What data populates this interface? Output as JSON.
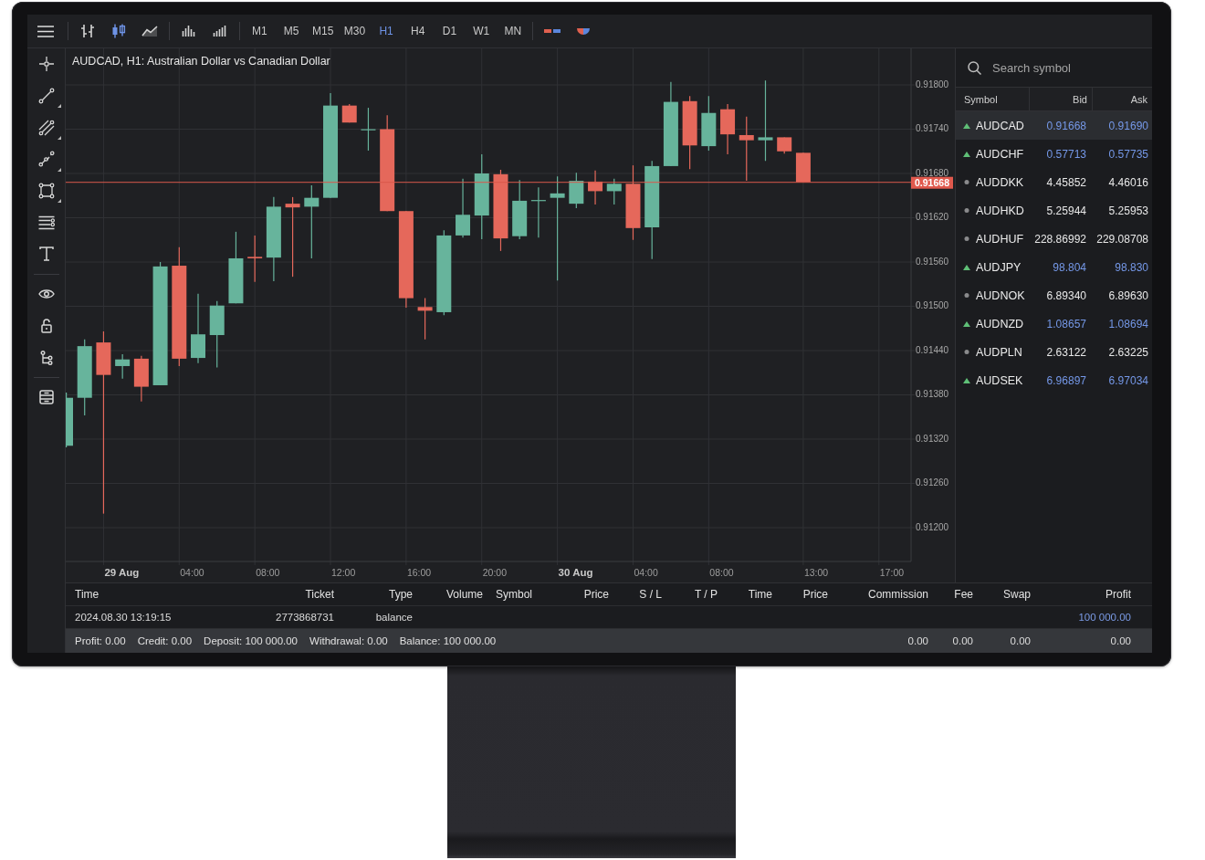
{
  "toolbar": {
    "chart_types": [
      {
        "kind": "bars",
        "selected": false
      },
      {
        "kind": "candles",
        "selected": true
      },
      {
        "kind": "line",
        "selected": false
      }
    ],
    "volume_tools": [
      {
        "kind": "histogram"
      },
      {
        "kind": "rising_bars"
      }
    ],
    "timeframes": [
      {
        "label": "M1",
        "selected": false
      },
      {
        "label": "M5",
        "selected": false
      },
      {
        "label": "M15",
        "selected": false
      },
      {
        "label": "M30",
        "selected": false
      },
      {
        "label": "H1",
        "selected": true
      },
      {
        "label": "H4",
        "selected": false
      },
      {
        "label": "D1",
        "selected": false
      },
      {
        "label": "W1",
        "selected": false
      },
      {
        "label": "MN",
        "selected": false
      }
    ],
    "extras": [
      {
        "kind": "dashes"
      },
      {
        "kind": "half_disc"
      }
    ]
  },
  "drawing_tools": {
    "groups": [
      {
        "items": [
          {
            "kind": "crosshair",
            "submenu": false
          },
          {
            "kind": "line",
            "submenu": true
          },
          {
            "kind": "channel",
            "submenu": true
          },
          {
            "kind": "polyline",
            "submenu": true
          },
          {
            "kind": "rectangle",
            "submenu": true
          },
          {
            "kind": "levels",
            "submenu": false
          },
          {
            "kind": "text",
            "submenu": false
          }
        ]
      },
      {
        "items": [
          {
            "kind": "eye",
            "submenu": false
          },
          {
            "kind": "lock",
            "submenu": false
          },
          {
            "kind": "tree",
            "submenu": false
          }
        ]
      },
      {
        "items": [
          {
            "kind": "layers",
            "submenu": false
          }
        ]
      }
    ]
  },
  "chart": {
    "title": "AUDCAD, H1: Australian Dollar vs Canadian Dollar",
    "price_axis": [
      "0.91800",
      "0.91740",
      "0.91680",
      "0.91620",
      "0.91560",
      "0.91500",
      "0.91440",
      "0.91380",
      "0.91320",
      "0.91260",
      "0.91200"
    ],
    "time_axis": [
      {
        "label": "29 Aug",
        "kind": "date"
      },
      {
        "label": "04:00",
        "kind": "time"
      },
      {
        "label": "08:00",
        "kind": "time"
      },
      {
        "label": "12:00",
        "kind": "time"
      },
      {
        "label": "16:00",
        "kind": "time"
      },
      {
        "label": "20:00",
        "kind": "time"
      },
      {
        "label": "30 Aug",
        "kind": "date"
      },
      {
        "label": "04:00",
        "kind": "time"
      },
      {
        "label": "08:00",
        "kind": "time"
      },
      {
        "label": "13:00",
        "kind": "time"
      },
      {
        "label": "17:00",
        "kind": "time"
      }
    ],
    "current_price": "0.91668"
  },
  "watchlist": {
    "search": {
      "placeholder": "Search symbol"
    },
    "columns": [
      "Symbol",
      "Bid",
      "Ask"
    ],
    "rows": [
      {
        "symbol": "AUDCAD",
        "bid": "0.91668",
        "ask": "0.91690",
        "rising": true,
        "selected": true
      },
      {
        "symbol": "AUDCHF",
        "bid": "0.57713",
        "ask": "0.57735",
        "rising": true,
        "selected": false
      },
      {
        "symbol": "AUDDKK",
        "bid": "4.45852",
        "ask": "4.46016",
        "rising": false,
        "selected": false
      },
      {
        "symbol": "AUDHKD",
        "bid": "5.25944",
        "ask": "5.25953",
        "rising": false,
        "selected": false
      },
      {
        "symbol": "AUDHUF",
        "bid": "228.86992",
        "ask": "229.08708",
        "rising": false,
        "selected": false
      },
      {
        "symbol": "AUDJPY",
        "bid": "98.804",
        "ask": "98.830",
        "rising": true,
        "selected": false
      },
      {
        "symbol": "AUDNOK",
        "bid": "6.89340",
        "ask": "6.89630",
        "rising": false,
        "selected": false
      },
      {
        "symbol": "AUDNZD",
        "bid": "1.08657",
        "ask": "1.08694",
        "rising": true,
        "selected": false
      },
      {
        "symbol": "AUDPLN",
        "bid": "2.63122",
        "ask": "2.63225",
        "rising": false,
        "selected": false
      },
      {
        "symbol": "AUDSEK",
        "bid": "6.96897",
        "ask": "6.97034",
        "rising": true,
        "selected": false
      }
    ]
  },
  "trade_history": {
    "columns": [
      "Time",
      "Ticket",
      "Type",
      "Volume",
      "Symbol",
      "Price",
      "S / L",
      "T / P",
      "Time",
      "Price",
      "Commission",
      "Fee",
      "Swap",
      "Profit"
    ],
    "rows": [
      {
        "time": "2024.08.30 13:19:15",
        "ticket": "2773868731",
        "type": "balance",
        "profit": "100 000.00"
      }
    ],
    "summary": {
      "items": [
        "Profit: 0.00",
        "Credit: 0.00",
        "Deposit: 100 000.00",
        "Withdrawal: 0.00",
        "Balance: 100 000.00"
      ],
      "totals": [
        "0.00",
        "0.00",
        "0.00",
        "0.00"
      ]
    }
  }
}
